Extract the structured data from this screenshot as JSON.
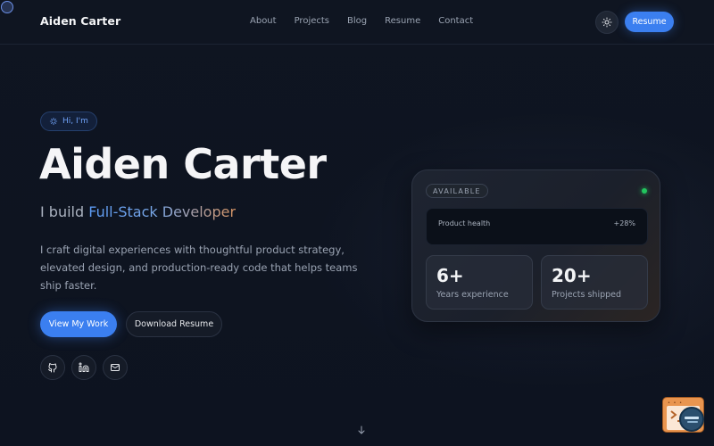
{
  "header": {
    "brand": "Aiden Carter",
    "nav": [
      "About",
      "Projects",
      "Blog",
      "Resume",
      "Contact"
    ],
    "theme_icon": "sun-icon",
    "resume_label": "Resume"
  },
  "hero": {
    "greeting": "Hi, I'm",
    "greeting_icon": "sparkle-icon",
    "name": "Aiden Carter",
    "tagline_prefix": "I build ",
    "tagline_role": "Full-Stack Developer",
    "description": "I craft digital experiences with thoughtful product strategy, elevated design, and production-ready code that helps teams ship faster.",
    "primary_cta": "View My Work",
    "secondary_cta": "Download Resume",
    "socials": [
      "github-icon",
      "linkedin-icon",
      "mail-icon"
    ]
  },
  "card": {
    "badge": "AVAILABLE",
    "status_color": "#22c55e",
    "health_label": "Product health",
    "health_value": "+28%",
    "stats": [
      {
        "value": "6+",
        "label": "Years experience"
      },
      {
        "value": "20+",
        "label": "Projects shipped"
      }
    ]
  },
  "colors": {
    "accent": "#3b7ff0",
    "background": "#0d1320"
  }
}
